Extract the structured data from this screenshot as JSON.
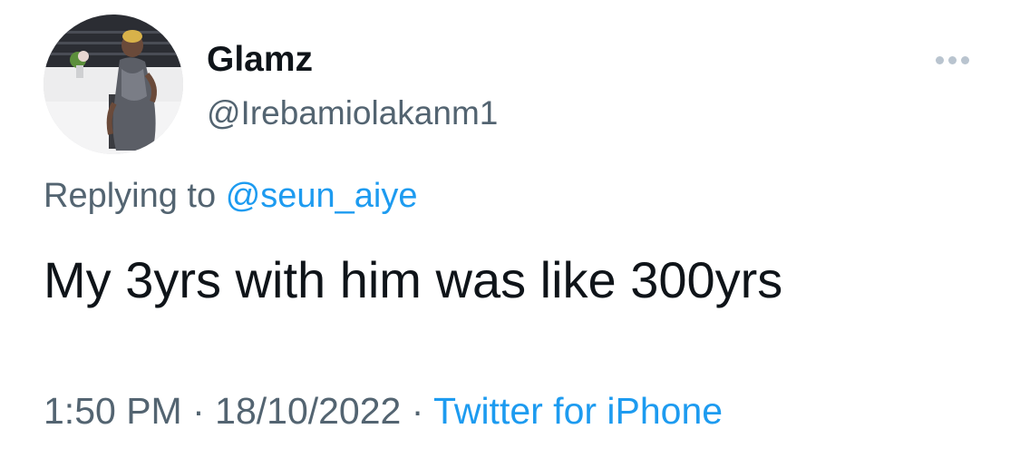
{
  "user": {
    "display_name": "Glamz",
    "handle": "@Irebamiolakanm1"
  },
  "reply": {
    "prefix": "Replying to",
    "mention": "@seun_aiye"
  },
  "tweet": {
    "text": "My 3yrs with him was like 300yrs"
  },
  "meta": {
    "time": "1:50 PM",
    "separator1": " · ",
    "date": "18/10/2022",
    "separator2": " · ",
    "source": "Twitter for iPhone"
  },
  "icons": {
    "more": "more-horizontal-icon"
  },
  "colors": {
    "text_primary": "#0f1419",
    "text_secondary": "#536471",
    "link": "#1d9bf0",
    "more_icon": "#b9c4cf"
  }
}
